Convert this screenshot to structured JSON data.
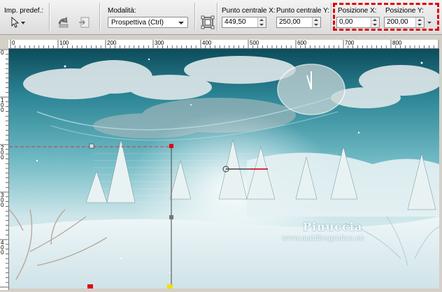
{
  "toolbar": {
    "presets_label": "Imp. predef.:",
    "mode_label": "Modalità:",
    "mode_value": "Prospettiva (Ctrl)",
    "center_x_label": "Punto centrale X:",
    "center_x_value": "449,50",
    "center_y_label": "Punto centrale Y:",
    "center_y_value": "250,00",
    "position_x_label": "Posizione X:",
    "position_x_value": "0,00",
    "position_y_label": "Posizione Y:",
    "position_y_value": "200,00",
    "highlight_color": "#e00000"
  },
  "rulers": {
    "top_labels": [
      "0",
      "100",
      "200",
      "300",
      "400",
      "500",
      "600",
      "700",
      "800"
    ],
    "left_labels": [
      "0",
      "1\n0\n0",
      "2\n0\n0",
      "3\n0\n0",
      "4\n0\n0"
    ]
  },
  "canvas": {
    "watermark_name": "Pinuccia",
    "watermark_site": "www.maidiregrafica.eu",
    "handle_color": "#e0001a"
  }
}
